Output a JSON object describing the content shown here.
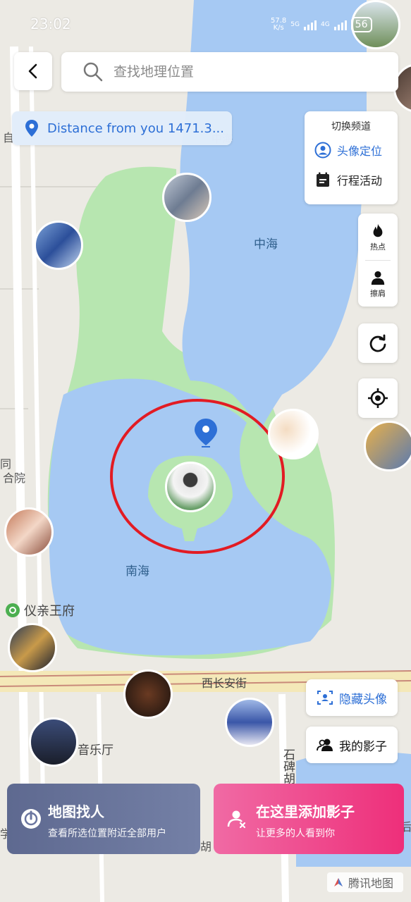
{
  "status_bar": {
    "time": "23:02",
    "net_speed_top": "57.8",
    "net_speed_unit": "K/s",
    "net1": "5G",
    "net2": "4G",
    "battery": "56"
  },
  "search": {
    "placeholder": "查找地理位置"
  },
  "location": {
    "distance_text": "Distance from you 1471.3..."
  },
  "channel_panel": {
    "title": "切换频道",
    "items": [
      {
        "label": "头像定位",
        "icon": "person-circle-icon",
        "active": true
      },
      {
        "label": "行程活动",
        "icon": "calendar-icon",
        "active": false
      }
    ]
  },
  "tools": {
    "hot_label": "热点",
    "brush_label": "擦肩",
    "refresh_icon": "refresh-icon",
    "locate_icon": "locate-icon"
  },
  "buttons": {
    "hide_avatar": "隐藏头像",
    "my_shadow": "我的影子"
  },
  "cards": {
    "find_people_title": "地图找人",
    "find_people_sub": "查看所选位置附近全部用户",
    "add_shadow_title": "在这里添加影子",
    "add_shadow_sub": "让更多的人看到你"
  },
  "map": {
    "lake_north": "中海",
    "lake_south": "南海",
    "landmark": "仪亲王府",
    "street": "西长安街",
    "concert_hall": "音乐厅",
    "stone_road": "石碑胡",
    "left_label_1": "同",
    "left_label_2": "合院",
    "cut_label_right": "后",
    "lake_top_fragment": "中海",
    "bottom_label": "胡",
    "left_edge_a": "自",
    "left_edge_b": "学"
  },
  "provider": "腾讯地图",
  "colors": {
    "water": "#a6c9f3",
    "park": "#b7e6b0",
    "accent_blue": "#2d6fd6",
    "accent_pink": "#ee2f7a",
    "marker_circle": "#e21b23"
  }
}
